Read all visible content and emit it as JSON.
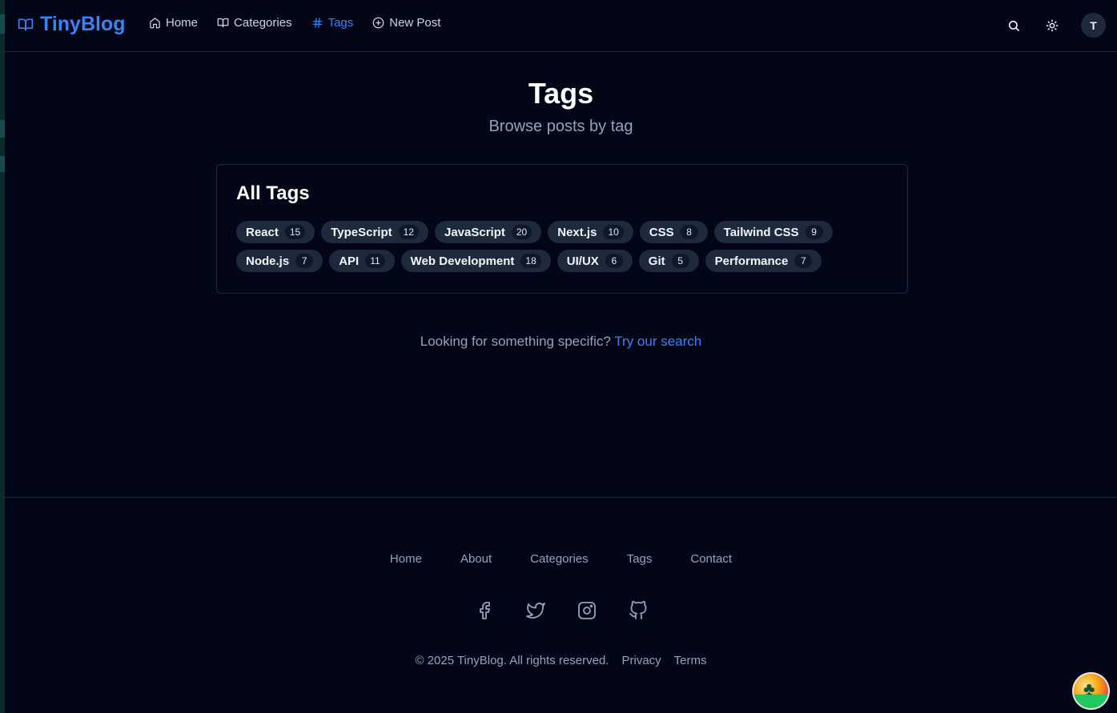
{
  "header": {
    "brand": "TinyBlog",
    "nav": [
      {
        "label": "Home",
        "icon": "home-icon",
        "active": false
      },
      {
        "label": "Categories",
        "icon": "book-icon",
        "active": false
      },
      {
        "label": "Tags",
        "icon": "hash-icon",
        "active": true
      },
      {
        "label": "New Post",
        "icon": "plus-circle-icon",
        "active": false
      }
    ],
    "actions": {
      "search_icon": "search-icon",
      "theme_icon": "sun-icon",
      "avatar_initial": "T"
    }
  },
  "page": {
    "title": "Tags",
    "subtitle": "Browse posts by tag"
  },
  "tags_card": {
    "title": "All Tags",
    "tags": [
      {
        "name": "React",
        "count": "15"
      },
      {
        "name": "TypeScript",
        "count": "12"
      },
      {
        "name": "JavaScript",
        "count": "20"
      },
      {
        "name": "Next.js",
        "count": "10"
      },
      {
        "name": "CSS",
        "count": "8"
      },
      {
        "name": "Tailwind CSS",
        "count": "9"
      },
      {
        "name": "Node.js",
        "count": "7"
      },
      {
        "name": "API",
        "count": "11"
      },
      {
        "name": "Web Development",
        "count": "18"
      },
      {
        "name": "UI/UX",
        "count": "6"
      },
      {
        "name": "Git",
        "count": "5"
      },
      {
        "name": "Performance",
        "count": "7"
      }
    ]
  },
  "search_hint": {
    "text": "Looking for something specific?",
    "link": "Try our search"
  },
  "footer": {
    "links": [
      "Home",
      "About",
      "Categories",
      "Tags",
      "Contact"
    ],
    "social": [
      "facebook-icon",
      "twitter-icon",
      "instagram-icon",
      "github-icon"
    ],
    "copyright": "© 2025 TinyBlog. All rights reserved.",
    "privacy": "Privacy",
    "terms": "Terms"
  },
  "colors": {
    "background": "#020617",
    "accent": "#3b82f6",
    "muted": "#94a3b8",
    "tag_bg": "#1e293b"
  }
}
